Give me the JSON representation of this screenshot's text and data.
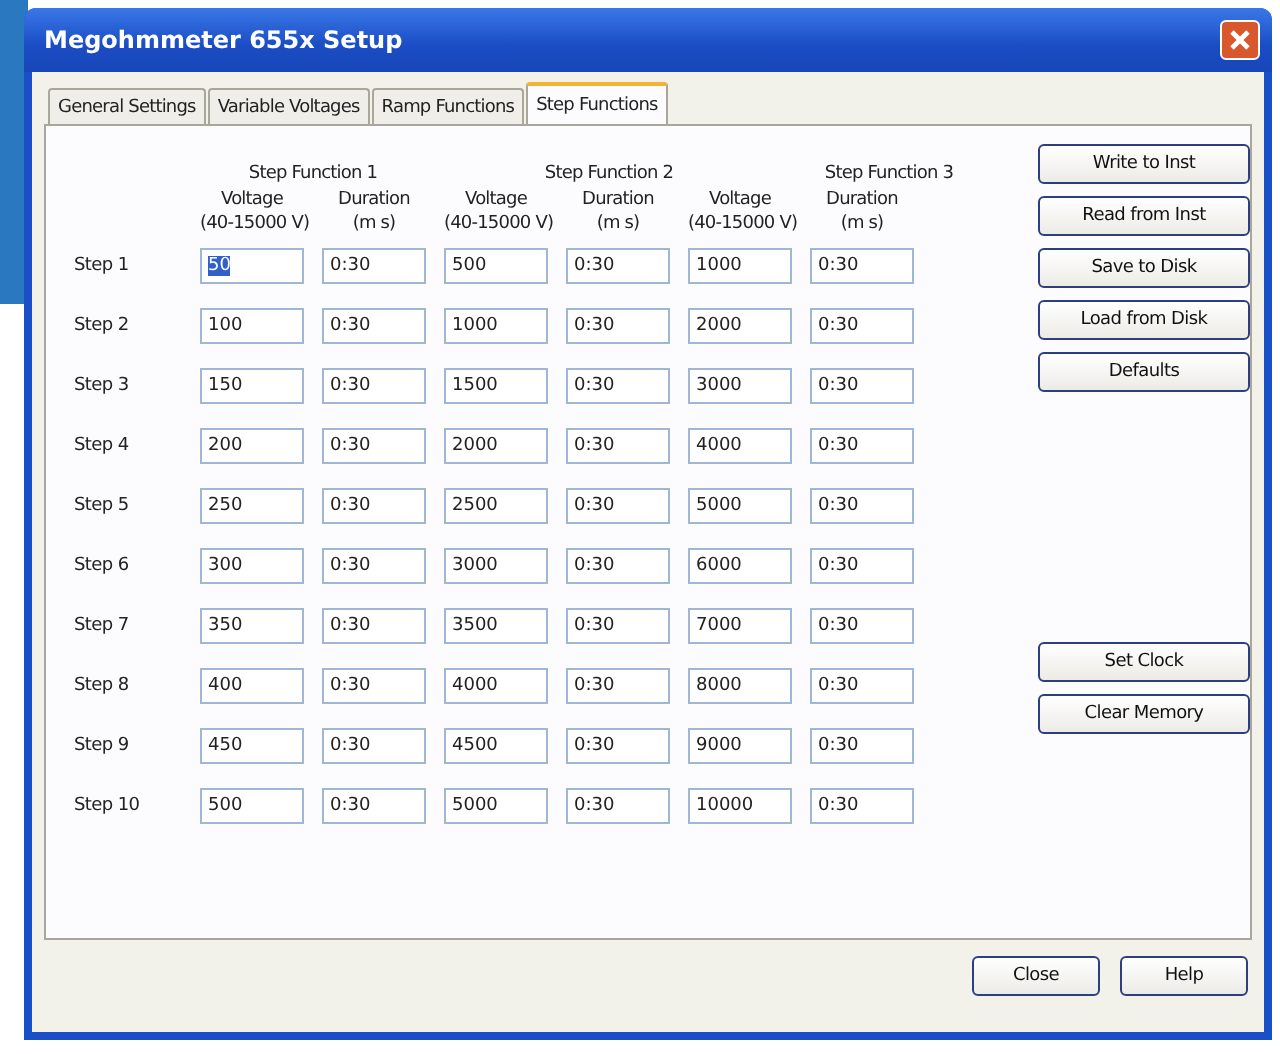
{
  "window": {
    "title": "Megohmmeter 655x Setup"
  },
  "tabs": [
    {
      "label": "General Settings",
      "selected": false
    },
    {
      "label": "Variable Voltages",
      "selected": false
    },
    {
      "label": "Ramp Functions",
      "selected": false
    },
    {
      "label": "Step Functions",
      "selected": true
    }
  ],
  "functions": [
    {
      "title": "Step Function 1",
      "voltage_header": "Voltage",
      "voltage_range": "(40-15000 V)",
      "duration_header": "Duration",
      "duration_unit": "(m s)"
    },
    {
      "title": "Step Function 2",
      "voltage_header": "Voltage",
      "voltage_range": "(40-15000 V)",
      "duration_header": "Duration",
      "duration_unit": "(m s)"
    },
    {
      "title": "Step Function 3",
      "voltage_header": "Voltage",
      "voltage_range": "(40-15000 V)",
      "duration_header": "Duration",
      "duration_unit": "(m s)"
    }
  ],
  "steps": [
    {
      "label": "Step 1",
      "cells": [
        {
          "voltage": "50",
          "duration": "0:30",
          "selected": true
        },
        {
          "voltage": "500",
          "duration": "0:30",
          "selected": false
        },
        {
          "voltage": "1000",
          "duration": "0:30",
          "selected": false
        }
      ]
    },
    {
      "label": "Step 2",
      "cells": [
        {
          "voltage": "100",
          "duration": "0:30",
          "selected": false
        },
        {
          "voltage": "1000",
          "duration": "0:30",
          "selected": false
        },
        {
          "voltage": "2000",
          "duration": "0:30",
          "selected": false
        }
      ]
    },
    {
      "label": "Step 3",
      "cells": [
        {
          "voltage": "150",
          "duration": "0:30",
          "selected": false
        },
        {
          "voltage": "1500",
          "duration": "0:30",
          "selected": false
        },
        {
          "voltage": "3000",
          "duration": "0:30",
          "selected": false
        }
      ]
    },
    {
      "label": "Step 4",
      "cells": [
        {
          "voltage": "200",
          "duration": "0:30",
          "selected": false
        },
        {
          "voltage": "2000",
          "duration": "0:30",
          "selected": false
        },
        {
          "voltage": "4000",
          "duration": "0:30",
          "selected": false
        }
      ]
    },
    {
      "label": "Step 5",
      "cells": [
        {
          "voltage": "250",
          "duration": "0:30",
          "selected": false
        },
        {
          "voltage": "2500",
          "duration": "0:30",
          "selected": false
        },
        {
          "voltage": "5000",
          "duration": "0:30",
          "selected": false
        }
      ]
    },
    {
      "label": "Step 6",
      "cells": [
        {
          "voltage": "300",
          "duration": "0:30",
          "selected": false
        },
        {
          "voltage": "3000",
          "duration": "0:30",
          "selected": false
        },
        {
          "voltage": "6000",
          "duration": "0:30",
          "selected": false
        }
      ]
    },
    {
      "label": "Step 7",
      "cells": [
        {
          "voltage": "350",
          "duration": "0:30",
          "selected": false
        },
        {
          "voltage": "3500",
          "duration": "0:30",
          "selected": false
        },
        {
          "voltage": "7000",
          "duration": "0:30",
          "selected": false
        }
      ]
    },
    {
      "label": "Step 8",
      "cells": [
        {
          "voltage": "400",
          "duration": "0:30",
          "selected": false
        },
        {
          "voltage": "4000",
          "duration": "0:30",
          "selected": false
        },
        {
          "voltage": "8000",
          "duration": "0:30",
          "selected": false
        }
      ]
    },
    {
      "label": "Step 9",
      "cells": [
        {
          "voltage": "450",
          "duration": "0:30",
          "selected": false
        },
        {
          "voltage": "4500",
          "duration": "0:30",
          "selected": false
        },
        {
          "voltage": "9000",
          "duration": "0:30",
          "selected": false
        }
      ]
    },
    {
      "label": "Step 10",
      "cells": [
        {
          "voltage": "500",
          "duration": "0:30",
          "selected": false
        },
        {
          "voltage": "5000",
          "duration": "0:30",
          "selected": false
        },
        {
          "voltage": "10000",
          "duration": "0:30",
          "selected": false
        }
      ]
    }
  ],
  "side_buttons_top": [
    "Write to Inst",
    "Read from Inst",
    "Save to Disk",
    "Load from Disk",
    "Defaults"
  ],
  "side_buttons_bottom": [
    "Set Clock",
    "Clear Memory"
  ],
  "footer_buttons": [
    "Close",
    "Help"
  ]
}
